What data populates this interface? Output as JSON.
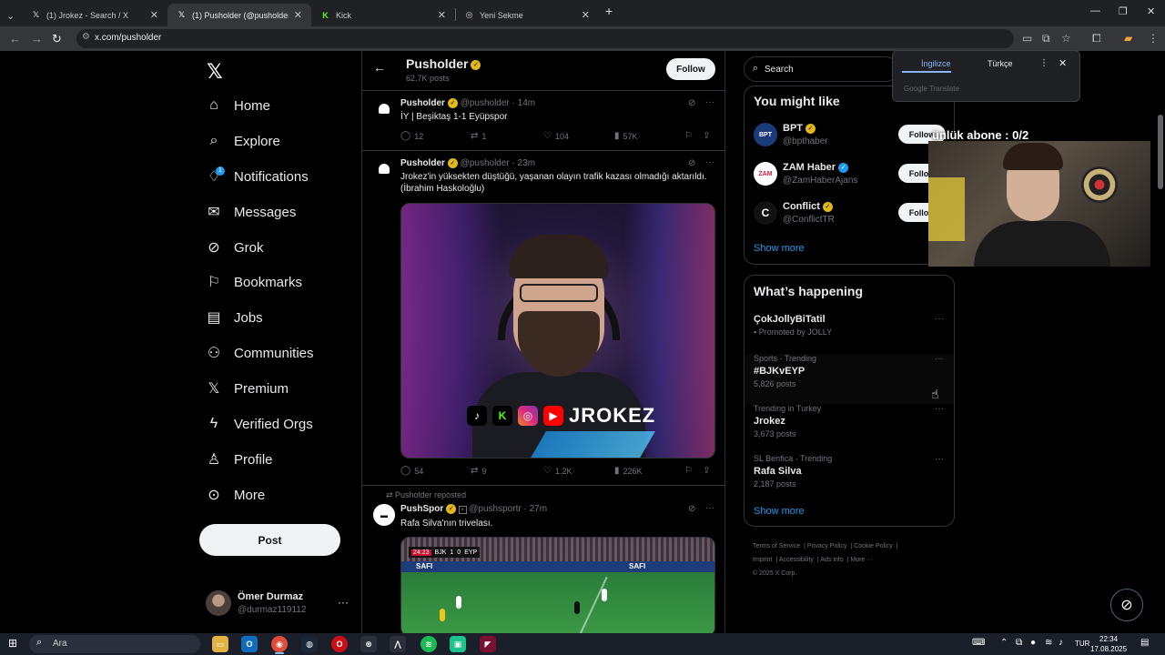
{
  "browser": {
    "tabs": [
      {
        "title": "(1) Jrokez - Search / X",
        "icon": "x-icon",
        "active": false
      },
      {
        "title": "(1) Pusholder (@pusholder) / X",
        "icon": "x-icon",
        "active": true
      },
      {
        "title": "Kick",
        "icon": "kick-icon",
        "active": false
      },
      {
        "title": "Yeni Sekme",
        "icon": "new-tab-icon",
        "active": false
      }
    ],
    "url": "x.com/pusholder"
  },
  "translate_popup": {
    "lang_from": "İngilizce",
    "lang_to": "Türkçe",
    "brand": "Google Translate"
  },
  "sidebar": {
    "items": [
      {
        "label": "Home",
        "icon": "home-icon"
      },
      {
        "label": "Explore",
        "icon": "search-icon"
      },
      {
        "label": "Notifications",
        "icon": "bell-icon",
        "badge": "1"
      },
      {
        "label": "Messages",
        "icon": "mail-icon"
      },
      {
        "label": "Grok",
        "icon": "grok-icon"
      },
      {
        "label": "Bookmarks",
        "icon": "bookmark-icon"
      },
      {
        "label": "Jobs",
        "icon": "briefcase-icon"
      },
      {
        "label": "Communities",
        "icon": "people-icon"
      },
      {
        "label": "Premium",
        "icon": "x-icon"
      },
      {
        "label": "Verified Orgs",
        "icon": "lightning-icon"
      },
      {
        "label": "Profile",
        "icon": "person-icon"
      },
      {
        "label": "More",
        "icon": "more-circle-icon"
      }
    ],
    "post_label": "Post",
    "user": {
      "name": "Ömer Durmaz",
      "handle": "@durmaz119112"
    }
  },
  "profile": {
    "name": "Pusholder",
    "posts": "62.7K posts",
    "follow_label": "Follow"
  },
  "tweets": [
    {
      "name": "Pusholder",
      "handle": "@pusholder",
      "time": "14m",
      "text": "İY | Beşiktaş 1-1 Eyüpspor",
      "replies": "12",
      "reposts": "1",
      "likes": "104",
      "views": "57K"
    },
    {
      "name": "Pusholder",
      "handle": "@pusholder",
      "time": "23m",
      "text": "Jrokez'in yüksekten düştüğü, yaşanan olayın trafik kazası olmadığı aktarıldı. (İbrahim Haskoloğlu)",
      "media_caption": "JROKEZ",
      "replies": "54",
      "reposts": "9",
      "likes": "1.2K",
      "views": "226K"
    },
    {
      "repost_note": "Pusholder reposted",
      "name": "PushSpor",
      "handle": "@pushsportr",
      "time": "27m",
      "text": "Rafa Silva'nın trivelası.",
      "score": {
        "home": "BJK",
        "home_score": "1",
        "away_score": "0",
        "away": "EYP",
        "clock": "24:23"
      },
      "adboard": "SAFI"
    }
  ],
  "search": {
    "placeholder": "Search"
  },
  "who_to_follow": {
    "title": "You might like",
    "users": [
      {
        "name": "BPT",
        "handle": "@bpthaber",
        "avatar": "BPT",
        "follow": "Follow"
      },
      {
        "name": "ZAM Haber",
        "handle": "@ZamHaberAjans",
        "avatar": "ZAM",
        "follow": "Follow"
      },
      {
        "name": "Conflict",
        "handle": "@ConflictTR",
        "avatar": "C",
        "follow": "Follow"
      }
    ],
    "show_more": "Show more"
  },
  "happening": {
    "title": "What’s happening",
    "trends": [
      {
        "meta": "Promoted by JOLLY",
        "name": "ÇokJollyBiTatil",
        "posts": ""
      },
      {
        "meta": "Sports · Trending",
        "name": "#BJKvEYP",
        "posts": "5,826 posts"
      },
      {
        "meta": "Trending in Turkey",
        "name": "Jrokez",
        "posts": "3,673 posts"
      },
      {
        "meta": "SL Benfica · Trending",
        "name": "Rafa Silva",
        "posts": "2,187 posts"
      }
    ],
    "show_more": "Show more"
  },
  "footer": {
    "links": [
      "Terms of Service",
      "Privacy Policy",
      "Cookie Policy",
      "Imprint",
      "Accessibility",
      "Ads info",
      "More ···"
    ],
    "copyright": "© 2025 X Corp."
  },
  "overlay": {
    "text": "ünlük abone : 0/2"
  },
  "taskbar": {
    "search_placeholder": "Ara",
    "lang": "TUR",
    "time": "22:34",
    "date": "17.08.2025"
  },
  "colors": {
    "accent": "#1d9bf0",
    "gold_verified": "#e2b719",
    "background": "#000000"
  }
}
